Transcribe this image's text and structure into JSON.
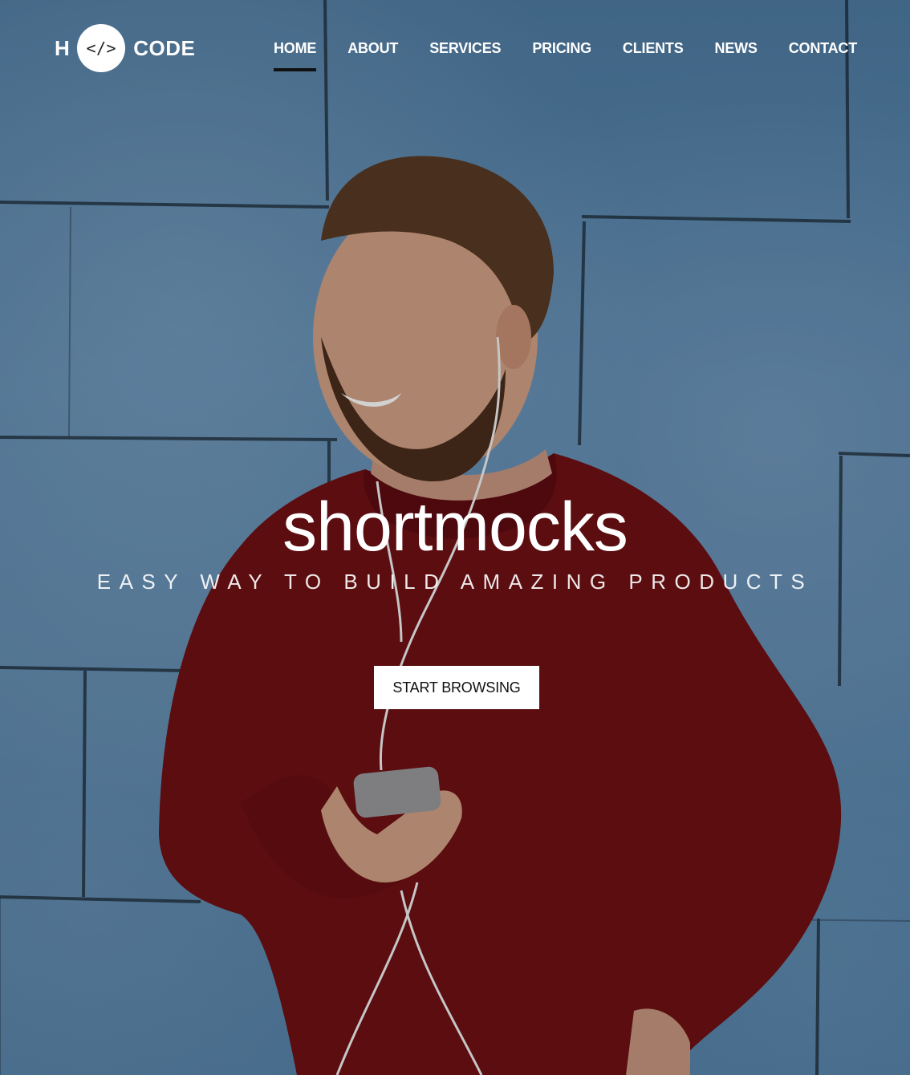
{
  "brand": {
    "left_text": "H",
    "badge_text": "</>",
    "right_text": "CODE"
  },
  "nav": {
    "items": [
      {
        "label": "HOME",
        "active": true
      },
      {
        "label": "ABOUT"
      },
      {
        "label": "SERVICES"
      },
      {
        "label": "PRICING"
      },
      {
        "label": "CLIENTS"
      },
      {
        "label": "NEWS"
      },
      {
        "label": "CONTACT"
      }
    ]
  },
  "hero": {
    "title": "shortmocks",
    "subtitle": "EASY WAY TO BUILD AMAZING PRODUCTS",
    "cta_label": "START BROWSING"
  },
  "colors": {
    "wall_blue": "#5a88b0",
    "sweater_red": "#7a1216",
    "text": "#ffffff",
    "active_underline": "#111111"
  }
}
